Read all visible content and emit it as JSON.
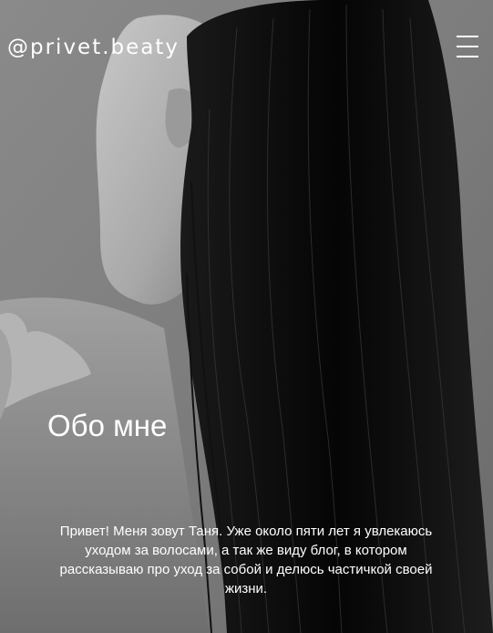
{
  "header": {
    "brand": "@privet.beaty",
    "menu_icon": "hamburger-menu-icon"
  },
  "hero": {
    "image": "black-and-white-photo-woman-with-long-dark-hair",
    "title": "Обо мне",
    "text": "Привет! Меня зовут Таня. Уже около пяти лет я увлекаюсь уходом за волосами, а так же виду блог, в котором рассказываю про уход за собой и делюсь частичкой своей жизни."
  },
  "colors": {
    "text": "#ffffff",
    "background": "#7a7a7a",
    "hair": "#0a0a0a"
  }
}
